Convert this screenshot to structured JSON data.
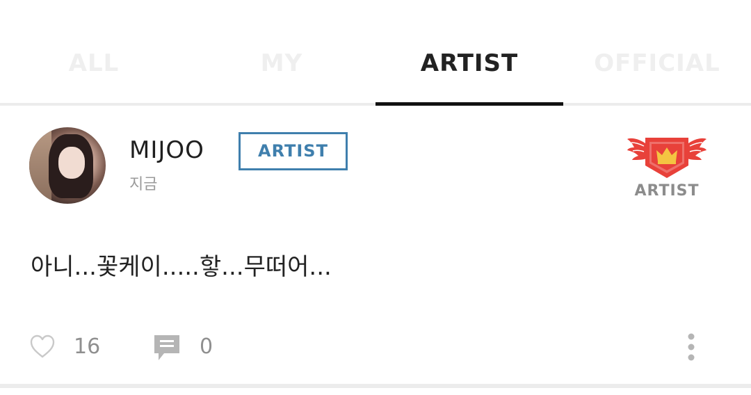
{
  "tabs": [
    {
      "label": "ALL",
      "active": false
    },
    {
      "label": "MY",
      "active": false
    },
    {
      "label": "ARTIST",
      "active": true
    },
    {
      "label": "OFFICIAL",
      "active": false
    }
  ],
  "post": {
    "author": "MIJOO",
    "badge": "ARTIST",
    "time": "지금",
    "emblem_label": "ARTIST",
    "text": "아니...꽃케이.....핳...무떠어...",
    "likes": "16",
    "comments": "0"
  },
  "icons": {
    "like": "heart-outline-icon",
    "comment": "comment-bubble-icon",
    "more": "vertical-dots-icon",
    "emblem": "winged-crown-shield-icon"
  },
  "colors": {
    "active_tab": "#222222",
    "inactive_tab": "#efefef",
    "badge_blue": "#3f7fad",
    "emblem_red": "#e8413a",
    "emblem_gold": "#f4c542",
    "muted": "#8f8f8f"
  }
}
